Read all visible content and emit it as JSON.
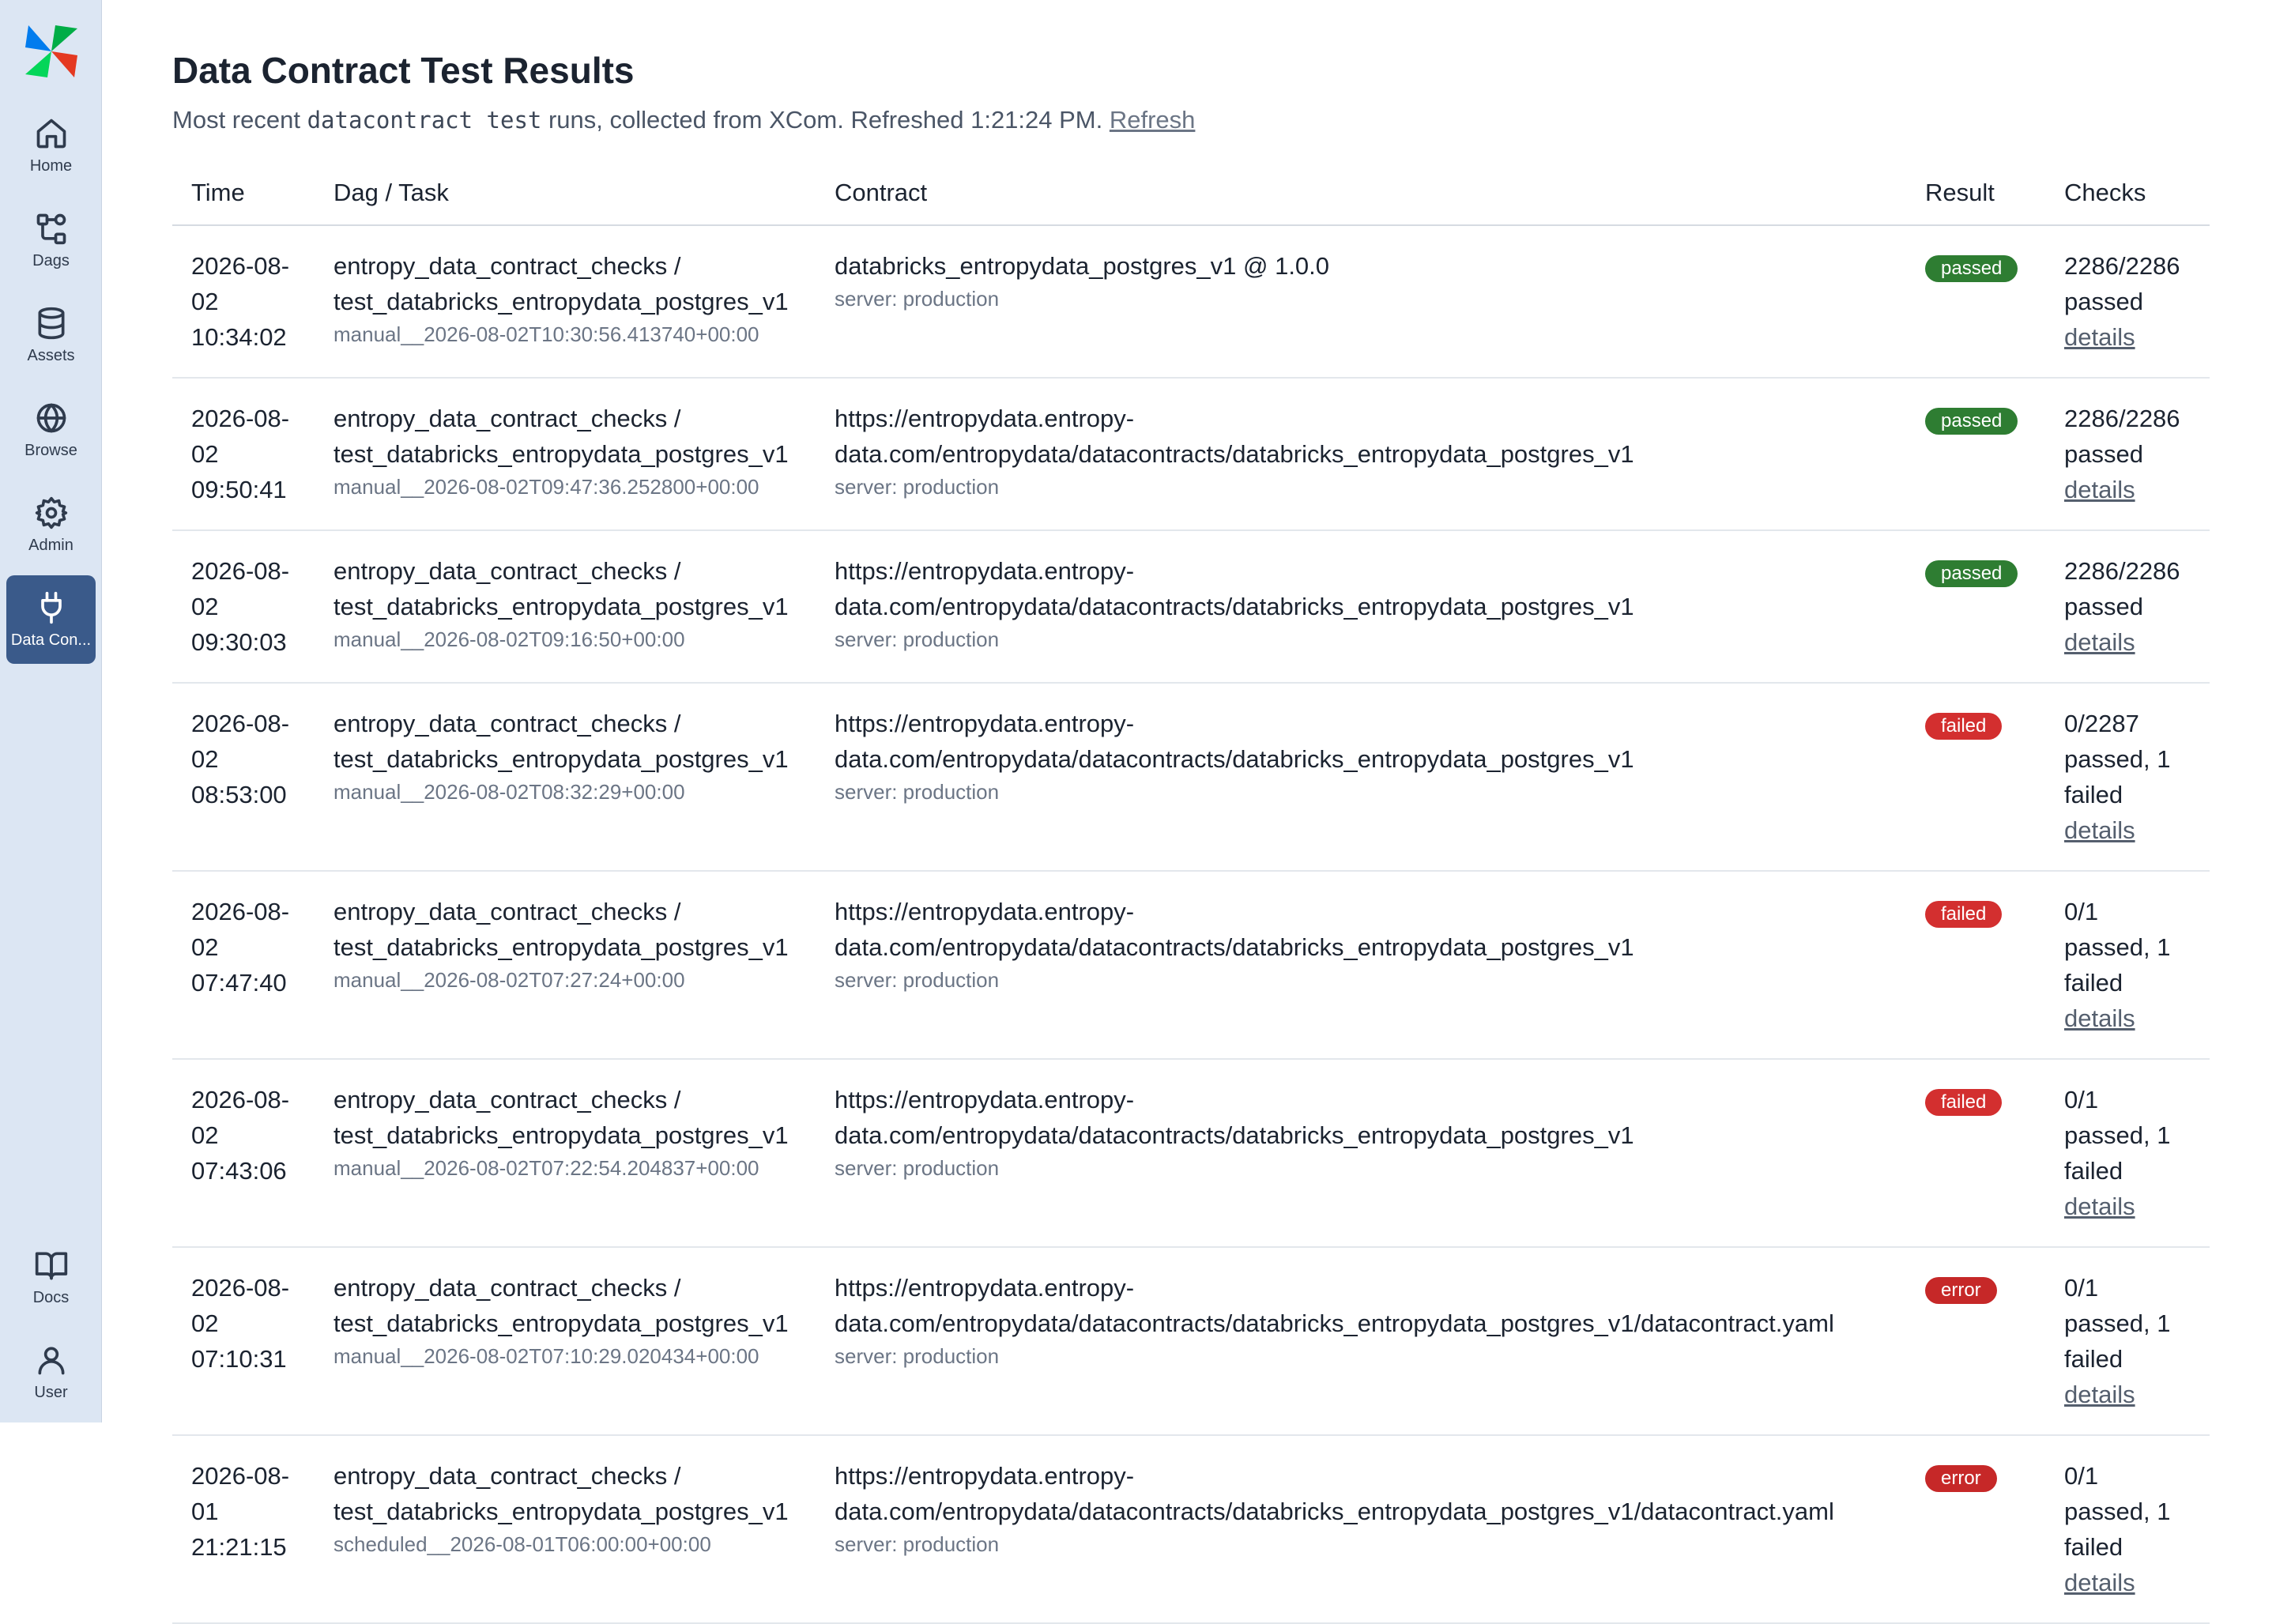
{
  "sidebar": {
    "items": [
      {
        "label": "Home",
        "icon": "home-icon"
      },
      {
        "label": "Dags",
        "icon": "dags-icon"
      },
      {
        "label": "Assets",
        "icon": "database-icon"
      },
      {
        "label": "Browse",
        "icon": "globe-icon"
      },
      {
        "label": "Admin",
        "icon": "gear-icon"
      },
      {
        "label": "Data Con...",
        "icon": "plug-icon",
        "active": true
      },
      {
        "label": "Docs",
        "icon": "book-icon"
      },
      {
        "label": "User",
        "icon": "user-icon"
      }
    ]
  },
  "header": {
    "title": "Data Contract Test Results",
    "subtitle_prefix": "Most recent ",
    "subtitle_code": "datacontract test",
    "subtitle_suffix": " runs, collected from XCom. Refreshed 1:21:24 PM. ",
    "refresh_label": "Refresh"
  },
  "table": {
    "columns": [
      "Time",
      "Dag / Task",
      "Contract",
      "Result",
      "Checks"
    ],
    "rows": [
      {
        "time_date": "2026-08-02",
        "time_clock": "10:34:02",
        "dag": "entropy_data_contract_checks /",
        "task": "test_databricks_entropydata_postgres_v1",
        "run": "manual__2026-08-02T10:30:56.413740+00:00",
        "contract": "databricks_entropydata_postgres_v1 @ 1.0.0",
        "server": "server: production",
        "result": "passed",
        "checks": "2286/2286 passed",
        "details": "details"
      },
      {
        "time_date": "2026-08-02",
        "time_clock": "09:50:41",
        "dag": "entropy_data_contract_checks /",
        "task": "test_databricks_entropydata_postgres_v1",
        "run": "manual__2026-08-02T09:47:36.252800+00:00",
        "contract": "https://entropydata.entropy-data.com/entropydata/datacontracts/databricks_entropydata_postgres_v1",
        "server": "server: production",
        "result": "passed",
        "checks": "2286/2286 passed",
        "details": "details"
      },
      {
        "time_date": "2026-08-02",
        "time_clock": "09:30:03",
        "dag": "entropy_data_contract_checks /",
        "task": "test_databricks_entropydata_postgres_v1",
        "run": "manual__2026-08-02T09:16:50+00:00",
        "contract": "https://entropydata.entropy-data.com/entropydata/datacontracts/databricks_entropydata_postgres_v1",
        "server": "server: production",
        "result": "passed",
        "checks": "2286/2286 passed",
        "details": "details"
      },
      {
        "time_date": "2026-08-02",
        "time_clock": "08:53:00",
        "dag": "entropy_data_contract_checks /",
        "task": "test_databricks_entropydata_postgres_v1",
        "run": "manual__2026-08-02T08:32:29+00:00",
        "contract": "https://entropydata.entropy-data.com/entropydata/datacontracts/databricks_entropydata_postgres_v1",
        "server": "server: production",
        "result": "failed",
        "checks": "0/2287 passed, 1 failed",
        "details": "details"
      },
      {
        "time_date": "2026-08-02",
        "time_clock": "07:47:40",
        "dag": "entropy_data_contract_checks /",
        "task": "test_databricks_entropydata_postgres_v1",
        "run": "manual__2026-08-02T07:27:24+00:00",
        "contract": "https://entropydata.entropy-data.com/entropydata/datacontracts/databricks_entropydata_postgres_v1",
        "server": "server: production",
        "result": "failed",
        "checks": "0/1 passed, 1 failed",
        "details": "details"
      },
      {
        "time_date": "2026-08-02",
        "time_clock": "07:43:06",
        "dag": "entropy_data_contract_checks /",
        "task": "test_databricks_entropydata_postgres_v1",
        "run": "manual__2026-08-02T07:22:54.204837+00:00",
        "contract": "https://entropydata.entropy-data.com/entropydata/datacontracts/databricks_entropydata_postgres_v1",
        "server": "server: production",
        "result": "failed",
        "checks": "0/1 passed, 1 failed",
        "details": "details"
      },
      {
        "time_date": "2026-08-02",
        "time_clock": "07:10:31",
        "dag": "entropy_data_contract_checks /",
        "task": "test_databricks_entropydata_postgres_v1",
        "run": "manual__2026-08-02T07:10:29.020434+00:00",
        "contract": "https://entropydata.entropy-data.com/entropydata/datacontracts/databricks_entropydata_postgres_v1/datacontract.yaml",
        "server": "server: production",
        "result": "error",
        "checks": "0/1 passed, 1 failed",
        "details": "details"
      },
      {
        "time_date": "2026-08-01",
        "time_clock": "21:21:15",
        "dag": "entropy_data_contract_checks /",
        "task": "test_databricks_entropydata_postgres_v1",
        "run": "scheduled__2026-08-01T06:00:00+00:00",
        "contract": "https://entropydata.entropy-data.com/entropydata/datacontracts/databricks_entropydata_postgres_v1/datacontract.yaml",
        "server": "server: production",
        "result": "error",
        "checks": "0/1 passed, 1 failed",
        "details": "details"
      }
    ]
  },
  "colors": {
    "passed": "#2e7d32",
    "failed": "#d32f2f",
    "error": "#c62828",
    "active_nav": "#3a5a8a"
  }
}
